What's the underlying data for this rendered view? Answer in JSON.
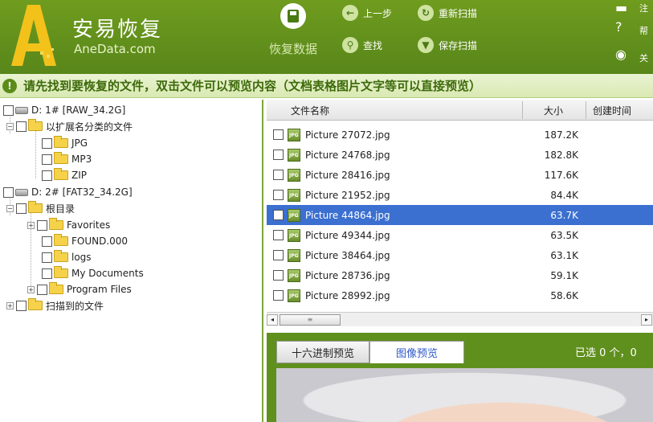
{
  "app": {
    "title": "安易恢复",
    "subtitle": "AneData.com"
  },
  "toolbar": {
    "recover_label": "恢复数据",
    "prev_label": "上一步",
    "rescan_label": "重新扫描",
    "find_label": "查找",
    "save_scan_label": "保存扫描",
    "right_labels": [
      "注",
      "帮",
      "关"
    ]
  },
  "hint": {
    "text": "请先找到要恢复的文件，双击文件可以预览内容（文档表格图片文字等可以直接预览）"
  },
  "tree": {
    "nodes": [
      {
        "label": "D:  1# [RAW_34.2G]"
      },
      {
        "label": "以扩展名分类的文件"
      },
      {
        "label": "JPG"
      },
      {
        "label": "MP3"
      },
      {
        "label": "ZIP"
      },
      {
        "label": "D:  2# [FAT32_34.2G]"
      },
      {
        "label": "根目录"
      },
      {
        "label": "Favorites"
      },
      {
        "label": "FOUND.000"
      },
      {
        "label": "logs"
      },
      {
        "label": "My Documents"
      },
      {
        "label": "Program Files"
      },
      {
        "label": "扫描到的文件"
      }
    ]
  },
  "files": {
    "columns": {
      "name": "文件名称",
      "size": "大小",
      "created": "创建时间"
    },
    "rows": [
      {
        "name": "Picture 27072.jpg",
        "size": "187.2K"
      },
      {
        "name": "Picture 24768.jpg",
        "size": "182.8K"
      },
      {
        "name": "Picture 28416.jpg",
        "size": "117.6K"
      },
      {
        "name": "Picture 21952.jpg",
        "size": "84.4K"
      },
      {
        "name": "Picture 44864.jpg",
        "size": "63.7K"
      },
      {
        "name": "Picture 49344.jpg",
        "size": "63.5K"
      },
      {
        "name": "Picture 38464.jpg",
        "size": "63.1K"
      },
      {
        "name": "Picture 28736.jpg",
        "size": "59.1K"
      },
      {
        "name": "Picture 28992.jpg",
        "size": "58.6K"
      }
    ],
    "selected_index": 4
  },
  "preview": {
    "hex_tab": "十六进制预览",
    "image_tab": "图像预览",
    "selection_info": "已选 0 个，0"
  },
  "colors": {
    "header_green": "#5f8f1d",
    "selection_blue": "#3b6fd0",
    "hint_text": "#3d6a0a"
  }
}
